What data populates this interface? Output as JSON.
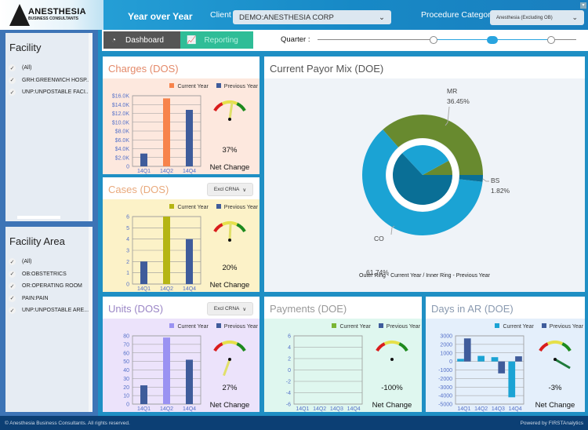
{
  "header": {
    "logo_line1": "ANESTHESIA",
    "logo_line2": "BUSINESS CONSULTANTS",
    "title": "Year over Year",
    "client_label": "Client",
    "client_value": "DEMO:ANESTHESIA CORP",
    "procedure_label": "Procedure Category",
    "procedure_value": "Anesthesia (Excluding OB)"
  },
  "nav": {
    "dashboard": "Dashboard",
    "reporting": "Reporting",
    "quarter_label": "Quarter :",
    "quarter_selected": 2,
    "quarter_range": [
      1,
      3
    ]
  },
  "sidebar": {
    "facility": {
      "title": "Facility",
      "items": [
        "(All)",
        "GRH:GREENWICH HOSP...",
        "UNP:UNPOSTABLE FACI..."
      ]
    },
    "facility_area": {
      "title": "Facility Area",
      "items": [
        "(All)",
        "OB:OBSTETRICS",
        "OR:OPERATING ROOM",
        "PAIN:PAIN",
        "UNP:UNPOSTABLE ARE..."
      ]
    }
  },
  "legend": {
    "current": "Current Year",
    "previous": "Previous Year"
  },
  "net_change_label": "Net Change",
  "excl_label": "Excl CRNA",
  "chart_data": [
    {
      "id": "charges",
      "title": "Charges (DOS)",
      "type": "bar",
      "categories": [
        "14Q1",
        "14Q2",
        "14Q4"
      ],
      "yticks": [
        "0",
        "$2.0K",
        "$4.0K",
        "$6.0K",
        "$8.0K",
        "$10.0K",
        "$12.0K",
        "$14.0K",
        "$16.0K"
      ],
      "ylim": [
        0,
        16000
      ],
      "colors": {
        "current": "#f7834b",
        "previous": "#3f5c9b"
      },
      "series": [
        {
          "name": "Current Year",
          "values": [
            null,
            15400,
            null
          ]
        },
        {
          "name": "Previous Year",
          "values": [
            2900,
            null,
            12800
          ]
        }
      ],
      "net_change": "37%"
    },
    {
      "id": "cases",
      "title": "Cases (DOS)",
      "type": "bar",
      "categories": [
        "14Q1",
        "14Q2",
        "14Q4"
      ],
      "yticks": [
        "0",
        "1",
        "2",
        "3",
        "4",
        "5",
        "6"
      ],
      "ylim": [
        0,
        6
      ],
      "colors": {
        "current": "#b5b514",
        "previous": "#3f5c9b"
      },
      "series": [
        {
          "name": "Current Year",
          "values": [
            null,
            6,
            null
          ]
        },
        {
          "name": "Previous Year",
          "values": [
            2,
            null,
            4
          ]
        }
      ],
      "net_change": "20%"
    },
    {
      "id": "units",
      "title": "Units (DOS)",
      "type": "bar",
      "categories": [
        "14Q1",
        "14Q2",
        "14Q4"
      ],
      "yticks": [
        "0",
        "10",
        "20",
        "30",
        "40",
        "50",
        "60",
        "70",
        "80"
      ],
      "ylim": [
        0,
        80
      ],
      "colors": {
        "current": "#9a92f2",
        "previous": "#3f5c9b"
      },
      "series": [
        {
          "name": "Current Year",
          "values": [
            null,
            78,
            null
          ]
        },
        {
          "name": "Previous Year",
          "values": [
            22,
            null,
            52
          ]
        }
      ],
      "net_change": "27%"
    },
    {
      "id": "payments",
      "title": "Payments (DOE)",
      "type": "bar",
      "categories": [
        "14Q1",
        "14Q2",
        "14Q3",
        "14Q4"
      ],
      "yticks": [
        "-6",
        "-4",
        "-2",
        "0",
        "2",
        "4",
        "6"
      ],
      "ylim": [
        -6,
        6
      ],
      "colors": {
        "current": "#7ab534",
        "previous": "#3f5c9b"
      },
      "series": [
        {
          "name": "Current Year",
          "values": [
            null,
            null,
            null,
            null
          ]
        },
        {
          "name": "Previous Year",
          "values": [
            null,
            null,
            null,
            null
          ]
        }
      ],
      "net_change": "-100%"
    },
    {
      "id": "days",
      "title": "Days in AR (DOE)",
      "type": "bar",
      "categories": [
        "14Q1",
        "14Q2",
        "14Q3",
        "14Q4"
      ],
      "yticks": [
        "-5000",
        "-4000",
        "-3000",
        "-2000",
        "-1000",
        "0",
        "1000",
        "2000",
        "3000"
      ],
      "ylim": [
        -5000,
        3000
      ],
      "colors": {
        "current": "#1ba3d4",
        "previous": "#3f5c9b"
      },
      "series": [
        {
          "name": "Current Year",
          "values": [
            300,
            650,
            500,
            -4200
          ]
        },
        {
          "name": "Previous Year",
          "values": [
            2700,
            null,
            -1400,
            600
          ]
        }
      ],
      "net_change": "-3%"
    },
    {
      "id": "payor",
      "title": "Current Payor Mix (DOE)",
      "type": "pie",
      "caption": "Outer Ring - Current Year / Inner Ring - Previous Year",
      "outer": [
        {
          "label": "MR",
          "value": 36.45,
          "text": "36.45%",
          "color": "#688a2f"
        },
        {
          "label": "CO",
          "value": 61.74,
          "text": "61.74%",
          "color": "#1ba3d4"
        },
        {
          "label": "BS",
          "value": 1.82,
          "text": "1.82%",
          "color": "#0a6f96"
        }
      ],
      "inner": [
        {
          "label": "MR",
          "value": 8,
          "color": "#688a2f"
        },
        {
          "label": "CO",
          "value": 29,
          "color": "#1ba3d4"
        },
        {
          "label": "BS",
          "value": 63,
          "color": "#0a6f96"
        }
      ]
    }
  ],
  "footer": {
    "left": "© Anesthesia Business Consultants. All rights reserved.",
    "right": "Powered by FIRSTAnalytics"
  }
}
